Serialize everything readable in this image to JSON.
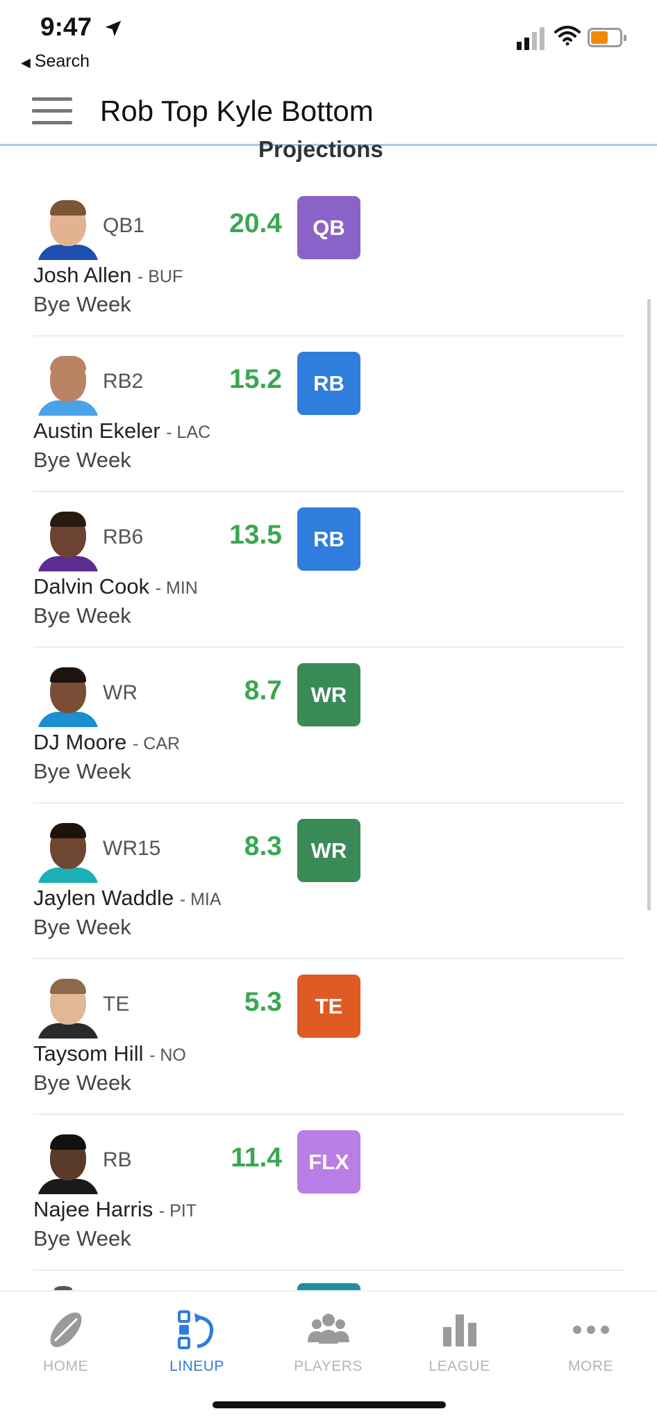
{
  "status_bar": {
    "time": "9:47",
    "back_label": "Search"
  },
  "header": {
    "title": "Rob Top Kyle Bottom"
  },
  "section_heading": "Projections",
  "players": [
    {
      "slot": "QB1",
      "projection": "20.4",
      "badge": "QB",
      "badge_color": "#8a63c9",
      "name": "Josh Allen",
      "team": "- BUF",
      "status": "Bye Week",
      "shirt_color": "#1c4fb0",
      "hair_color": "#7a5536",
      "skin_color": "#e3b391"
    },
    {
      "slot": "RB2",
      "projection": "15.2",
      "badge": "RB",
      "badge_color": "#2f7ddc",
      "name": "Austin Ekeler",
      "team": "- LAC",
      "status": "Bye Week",
      "shirt_color": "#4aa3e6",
      "hair_color": "#b98364",
      "skin_color": "#b98364"
    },
    {
      "slot": "RB6",
      "projection": "13.5",
      "badge": "RB",
      "badge_color": "#2f7ddc",
      "name": "Dalvin Cook",
      "team": "- MIN",
      "status": "Bye Week",
      "shirt_color": "#5a2d91",
      "hair_color": "#2a1a12",
      "skin_color": "#6b4330"
    },
    {
      "slot": "WR",
      "projection": "8.7",
      "badge": "WR",
      "badge_color": "#3a8a57",
      "name": "DJ Moore",
      "team": "- CAR",
      "status": "Bye Week",
      "shirt_color": "#1b8fd0",
      "hair_color": "#1e140e",
      "skin_color": "#7a4e36"
    },
    {
      "slot": "WR15",
      "projection": "8.3",
      "badge": "WR",
      "badge_color": "#3a8a57",
      "name": "Jaylen Waddle",
      "team": "- MIA",
      "status": "Bye Week",
      "shirt_color": "#1ab0b5",
      "hair_color": "#1e140e",
      "skin_color": "#6e4632"
    },
    {
      "slot": "TE",
      "projection": "5.3",
      "badge": "TE",
      "badge_color": "#e05a24",
      "name": "Taysom Hill",
      "team": "- NO",
      "status": "Bye Week",
      "shirt_color": "#2a2a2a",
      "hair_color": "#8c6a4c",
      "skin_color": "#e2b796"
    },
    {
      "slot": "RB",
      "projection": "11.4",
      "badge": "FLX",
      "badge_color": "#b97de6",
      "name": "Najee Harris",
      "team": "- PIT",
      "status": "Bye Week",
      "shirt_color": "#1a1a1a",
      "hair_color": "#111111",
      "skin_color": "#5a3a28"
    }
  ],
  "tabs": [
    {
      "label": "HOME",
      "icon": "football-icon",
      "active": false
    },
    {
      "label": "LINEUP",
      "icon": "lineup-swap-icon",
      "active": true
    },
    {
      "label": "PLAYERS",
      "icon": "players-group-icon",
      "active": false
    },
    {
      "label": "LEAGUE",
      "icon": "bar-chart-icon",
      "active": false
    },
    {
      "label": "MORE",
      "icon": "ellipsis-icon",
      "active": false
    }
  ],
  "colors": {
    "projection_green": "#3aa651",
    "active_tab": "#2f7be0",
    "inactive_tab": "#b5b5b5",
    "header_border": "#a8c6ec"
  }
}
